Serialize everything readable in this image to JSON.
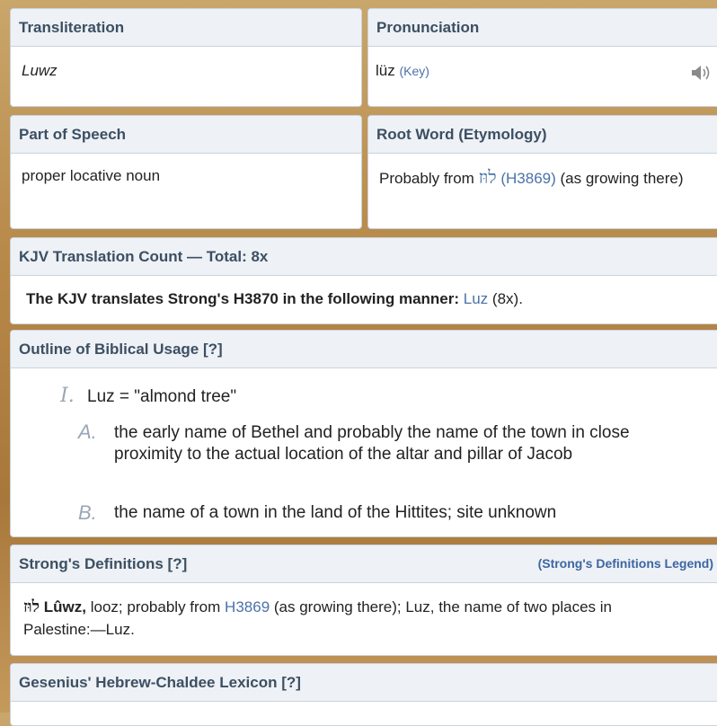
{
  "transliteration": {
    "header": "Transliteration",
    "value": "Luwz"
  },
  "pronunciation": {
    "header": "Pronunciation",
    "value": "lüz",
    "key_link": "(Key)",
    "audio_icon": "speaker-icon"
  },
  "part_of_speech": {
    "header": "Part of Speech",
    "value": "proper locative noun"
  },
  "root_word": {
    "header": "Root Word (Etymology)",
    "prefix": "Probably from",
    "hebrew": "לוּז",
    "ref_link": "(H3869)",
    "suffix": "(as growing there)"
  },
  "kjv_count": {
    "header": "KJV Translation Count — Total: 8x",
    "bold_text": "The KJV translates Strong's H3870 in the following manner:",
    "link": "Luz",
    "count": "(8x)."
  },
  "outline": {
    "header": "Outline of Biblical Usage [?]",
    "items": [
      {
        "marker": "I.",
        "text": "Luz = \"almond tree\""
      },
      {
        "marker": "A.",
        "text": "the early name of Bethel and probably the name of the town in close proximity to the actual location of the altar and pillar of Jacob"
      },
      {
        "marker": "B.",
        "text": "the name of a town in the land of the Hittites; site unknown"
      }
    ]
  },
  "strongs": {
    "header": "Strong's Definitions [?]",
    "legend_link": "(Strong's Definitions Legend)",
    "hebrew": "לוּז",
    "word": "Lûwz,",
    "text_before_link": "looz; probably from",
    "link": "H3869",
    "text_after_link": "(as growing there); Luz, the name of two places in Palestine:—Luz."
  },
  "gesenius": {
    "header": "Gesenius' Hebrew-Chaldee Lexicon [?]"
  }
}
